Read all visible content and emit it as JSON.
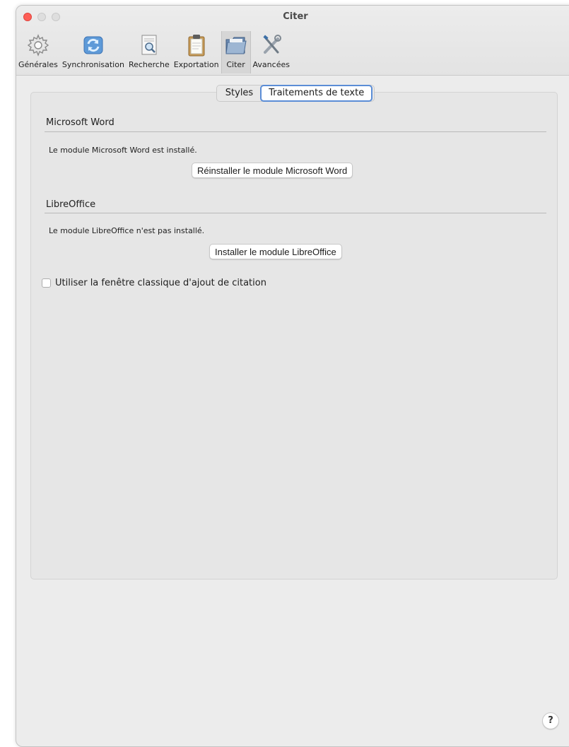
{
  "window": {
    "title": "Citer"
  },
  "toolbar": {
    "items": [
      {
        "label": "Générales",
        "icon": "gear-icon"
      },
      {
        "label": "Synchronisation",
        "icon": "sync-icon"
      },
      {
        "label": "Recherche",
        "icon": "search-document-icon"
      },
      {
        "label": "Exportation",
        "icon": "clipboard-icon"
      },
      {
        "label": "Citer",
        "icon": "folder-icon",
        "selected": true
      },
      {
        "label": "Avancées",
        "icon": "tools-icon"
      }
    ]
  },
  "tabs": {
    "items": [
      "Styles",
      "Traitements de texte"
    ],
    "active": "Traitements de texte"
  },
  "word": {
    "heading": "Microsoft Word",
    "status": "Le module Microsoft Word est installé.",
    "button": "Réinstaller le module Microsoft Word"
  },
  "libreoffice": {
    "heading": "LibreOffice",
    "status": "Le module LibreOffice n'est pas installé.",
    "button": "Installer le module LibreOffice"
  },
  "classic_dialog": {
    "label": "Utiliser la fenêtre classique d'ajout de citation",
    "checked": false
  },
  "help": {
    "label": "?"
  },
  "colors": {
    "close": "#fe5f57",
    "accent": "#5b8dd6"
  }
}
